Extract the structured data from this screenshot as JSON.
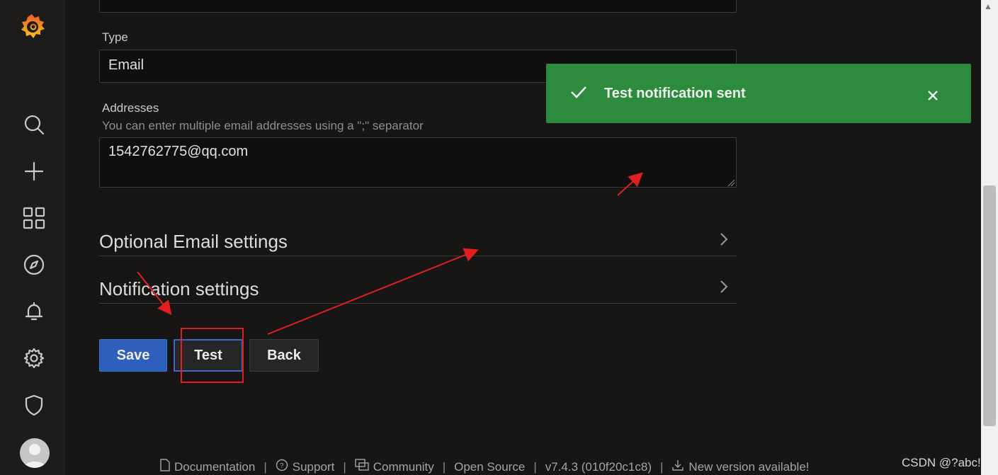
{
  "form": {
    "type_label": "Type",
    "type_value": "Email",
    "addresses_label": "Addresses",
    "addresses_desc": "You can enter multiple email addresses using a \";\" separator",
    "addresses_value": "1542762775@qq.com"
  },
  "sections": {
    "optional_email": "Optional Email settings",
    "notification": "Notification settings"
  },
  "buttons": {
    "save": "Save",
    "test": "Test",
    "back": "Back"
  },
  "toast": {
    "message": "Test notification sent",
    "close_icon": "×"
  },
  "footer": {
    "documentation": "Documentation",
    "support": "Support",
    "community": "Community",
    "open_source": "Open Source",
    "version": "v7.4.3 (010f20c1c8)",
    "new_version": "New version available!"
  },
  "watermark": "CSDN @?abc!",
  "colors": {
    "toast_bg": "#2d8b3d",
    "save_btn": "#2f5fbd",
    "annotation_red": "#e02020"
  }
}
